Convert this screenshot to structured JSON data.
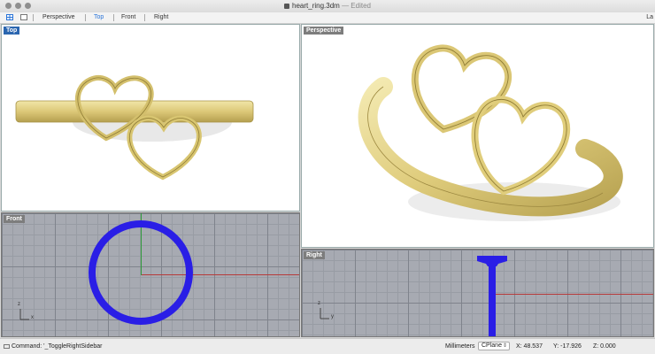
{
  "window": {
    "title": "heart_ring.3dm",
    "title_status": "— Edited"
  },
  "toolbar": {
    "tabs": [
      {
        "label": "Perspective",
        "active": false
      },
      {
        "label": "Top",
        "active": true
      },
      {
        "label": "Front",
        "active": false
      },
      {
        "label": "Right",
        "active": false
      }
    ],
    "right_clipped": "La"
  },
  "viewports": {
    "top": {
      "label": "Top",
      "active": true
    },
    "perspective": {
      "label": "Perspective",
      "active": false
    },
    "front": {
      "label": "Front",
      "active": false,
      "axis_x": "x",
      "axis_y": "z"
    },
    "right": {
      "label": "Right",
      "active": false,
      "axis_x": "y",
      "axis_y": "z"
    }
  },
  "colors": {
    "gold": "#e6d690",
    "gold_shadow": "#b9a453",
    "selection_blue": "#2a1ee6",
    "grid_bg": "#a7aab2"
  },
  "status": {
    "command": "Command: '_ToggleRightSidebar",
    "units": "Millimeters",
    "cplane": "CPlane",
    "x": "X: 48.537",
    "y": "Y: -17.926",
    "z": "Z: 0.000"
  }
}
